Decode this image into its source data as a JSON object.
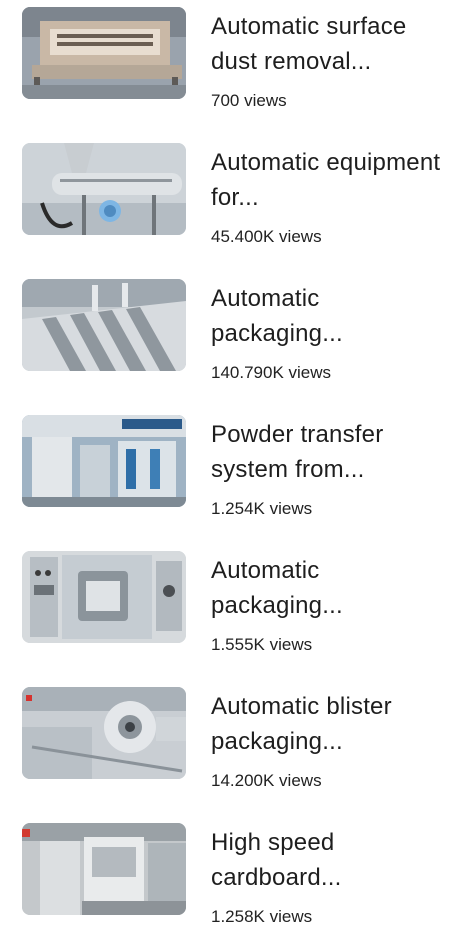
{
  "videos": [
    {
      "title": "Automatic surface dust removal...",
      "views": "700 views",
      "thumbnail": "dust-removal-machine-thumbnail"
    },
    {
      "title": "Automatic equipment for...",
      "views": "45.400K views",
      "thumbnail": "automatic-equipment-thumbnail"
    },
    {
      "title": "Automatic packaging...",
      "views": "140.790K views",
      "thumbnail": "packaging-line-thumbnail"
    },
    {
      "title": "Powder transfer system from...",
      "views": "1.254K views",
      "thumbnail": "powder-transfer-thumbnail"
    },
    {
      "title": "Automatic packaging...",
      "views": "1.555K views",
      "thumbnail": "packaging-machine-thumbnail"
    },
    {
      "title": "Automatic blister packaging...",
      "views": "14.200K views",
      "thumbnail": "blister-packaging-thumbnail"
    },
    {
      "title": "High speed cardboard...",
      "views": "1.258K views",
      "thumbnail": "cardboard-machine-thumbnail"
    }
  ]
}
